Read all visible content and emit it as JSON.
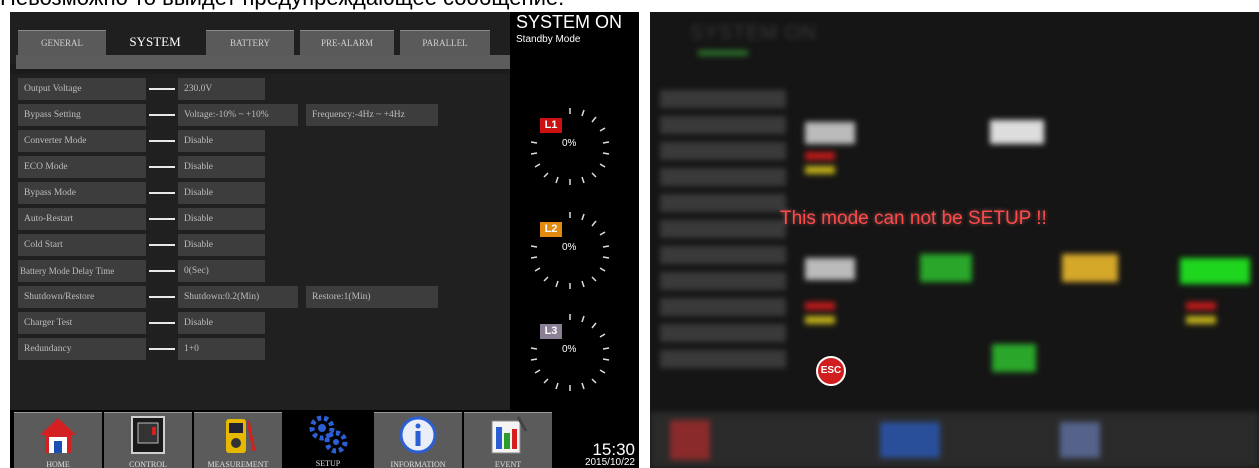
{
  "caption": "Невозможно то выйдет предупреждающее сообщение.",
  "tabs": [
    {
      "label": "GENERAL"
    },
    {
      "label": "SYSTEM"
    },
    {
      "label": "BATTERY"
    },
    {
      "label": "PRE-ALARM"
    },
    {
      "label": "PARALLEL"
    }
  ],
  "settings": [
    {
      "label": "Output Voltage",
      "value": "230.0V"
    },
    {
      "label": "Bypass Setting",
      "value": "Voltage:-10% ~ +10%",
      "value2": "Frequency:-4Hz ~ +4Hz"
    },
    {
      "label": "Converter Mode",
      "value": "Disable"
    },
    {
      "label": "ECO Mode",
      "value": "Disable"
    },
    {
      "label": "Bypass Mode",
      "value": "Disable"
    },
    {
      "label": "Auto-Restart",
      "value": "Disable"
    },
    {
      "label": "Cold Start",
      "value": "Disable"
    },
    {
      "label": "Battery Mode Delay Time",
      "value": "0(Sec)"
    },
    {
      "label": "Shutdown/Restore",
      "value": "Shutdown:0.2(Min)",
      "value2": "Restore:1(Min)"
    },
    {
      "label": "Charger Test",
      "value": "Disable"
    },
    {
      "label": "Redundancy",
      "value": "1+0"
    }
  ],
  "status": {
    "title": "SYSTEM ON",
    "mode": "Standby Mode",
    "gauges": [
      {
        "label": "L1",
        "percent": "0%",
        "color": "#cc1111"
      },
      {
        "label": "L2",
        "percent": "0%",
        "color": "#e08a10"
      },
      {
        "label": "L3",
        "percent": "0%",
        "color": "#8a7f95"
      }
    ]
  },
  "nav": [
    {
      "label": "HOME",
      "icon": "home-icon"
    },
    {
      "label": "CONTROL",
      "icon": "control-icon"
    },
    {
      "label": "MEASUREMENT",
      "icon": "meter-icon"
    },
    {
      "label": "SETUP",
      "icon": "gears-icon"
    },
    {
      "label": "INFORMATION",
      "icon": "info-icon"
    },
    {
      "label": "EVENT",
      "icon": "event-log-icon"
    }
  ],
  "clock": {
    "time": "15:30",
    "date": "2015/10/22"
  },
  "right": {
    "bg_title": "SYSTEM ON",
    "message": "This mode can not be SETUP !!",
    "esc_label": "ESC"
  }
}
